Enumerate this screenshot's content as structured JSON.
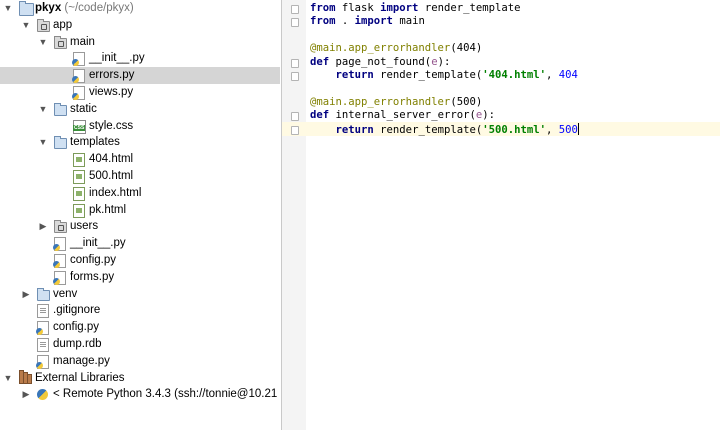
{
  "tree": {
    "rows": [
      {
        "label": "pkyx",
        "suffix": " (~/code/pkyx)",
        "bold": true
      },
      {
        "label": "app"
      },
      {
        "label": "main"
      },
      {
        "label": "__init__.py"
      },
      {
        "label": "errors.py"
      },
      {
        "label": "views.py"
      },
      {
        "label": "static"
      },
      {
        "label": "style.css"
      },
      {
        "label": "templates"
      },
      {
        "label": "404.html"
      },
      {
        "label": "500.html"
      },
      {
        "label": "index.html"
      },
      {
        "label": "pk.html"
      },
      {
        "label": "users"
      },
      {
        "label": "__init__.py"
      },
      {
        "label": "config.py"
      },
      {
        "label": "forms.py"
      },
      {
        "label": "venv"
      },
      {
        "label": ".gitignore"
      },
      {
        "label": "config.py"
      },
      {
        "label": "dump.rdb"
      },
      {
        "label": "manage.py"
      },
      {
        "label": "External Libraries"
      },
      {
        "label": "< Remote Python 3.4.3 (ssh://tonnie@10.21"
      }
    ]
  },
  "editor": {
    "lines": [
      {
        "t": [
          {
            "c": "kw",
            "v": "from"
          },
          {
            "c": "",
            "v": " flask "
          },
          {
            "c": "kw",
            "v": "import"
          },
          {
            "c": "",
            "v": " render_template"
          }
        ]
      },
      {
        "t": [
          {
            "c": "kw",
            "v": "from"
          },
          {
            "c": "",
            "v": " . "
          },
          {
            "c": "kw",
            "v": "import"
          },
          {
            "c": "",
            "v": " main"
          }
        ]
      },
      {
        "t": []
      },
      {
        "t": [
          {
            "c": "dec",
            "v": "@main.app_errorhandler"
          },
          {
            "c": "",
            "v": "(404)"
          }
        ]
      },
      {
        "t": [
          {
            "c": "kw",
            "v": "def"
          },
          {
            "c": "",
            "v": " page_not_found("
          },
          {
            "c": "param",
            "v": "e"
          },
          {
            "c": "",
            "v": "):"
          }
        ]
      },
      {
        "t": [
          {
            "c": "",
            "v": "    "
          },
          {
            "c": "kw",
            "v": "return"
          },
          {
            "c": "",
            "v": " render_template("
          },
          {
            "c": "str",
            "v": "'404.html'"
          },
          {
            "c": "",
            "v": ", "
          },
          {
            "c": "num",
            "v": "404"
          }
        ]
      },
      {
        "t": []
      },
      {
        "t": [
          {
            "c": "dec",
            "v": "@main.app_errorhandler"
          },
          {
            "c": "",
            "v": "(500)"
          }
        ]
      },
      {
        "t": [
          {
            "c": "kw",
            "v": "def"
          },
          {
            "c": "",
            "v": " internal_server_error("
          },
          {
            "c": "param",
            "v": "e"
          },
          {
            "c": "",
            "v": "):"
          }
        ]
      },
      {
        "t": [
          {
            "c": "",
            "v": "    "
          },
          {
            "c": "kw",
            "v": "return"
          },
          {
            "c": "",
            "v": " render_template("
          },
          {
            "c": "str",
            "v": "'500.html'"
          },
          {
            "c": "",
            "v": ", "
          },
          {
            "c": "num",
            "v": "500"
          }
        ]
      }
    ],
    "current_line": 10
  }
}
